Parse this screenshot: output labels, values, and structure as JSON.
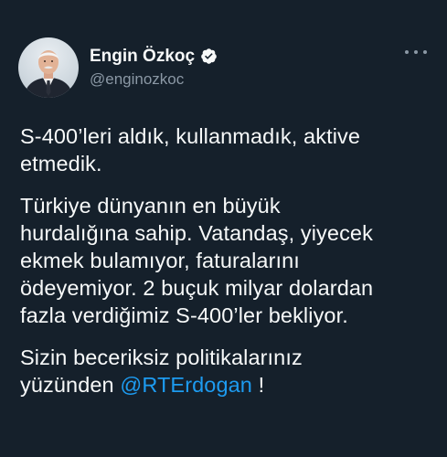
{
  "author": {
    "name": "Engin Özkoç",
    "handle": "@enginozkoc"
  },
  "icons": {
    "verified": "verified-badge-icon",
    "more": "more-options-icon",
    "avatar": "avatar"
  },
  "colors": {
    "background": "#15202b",
    "text": "#f7f9f9",
    "secondary": "#8b98a5",
    "accent": "#1d9bf0"
  },
  "tweet": {
    "p1": "S-400’leri aldık, kullanmadık, aktive\netmedik.",
    "p2": "Türkiye dünyanın en büyük\nhurdalığına sahip. Vatandaş, yiyecek\nekmek bulamıyor, faturalarını\nödeyemiyor. 2 buçuk milyar dolardan\nfazla verdiğimiz S-400’ler bekliyor.",
    "p3_prefix": "Sizin beceriksiz politikalarınız\nyüzünden ",
    "p3_mention": "@RTErdogan",
    "p3_suffix": " !"
  }
}
